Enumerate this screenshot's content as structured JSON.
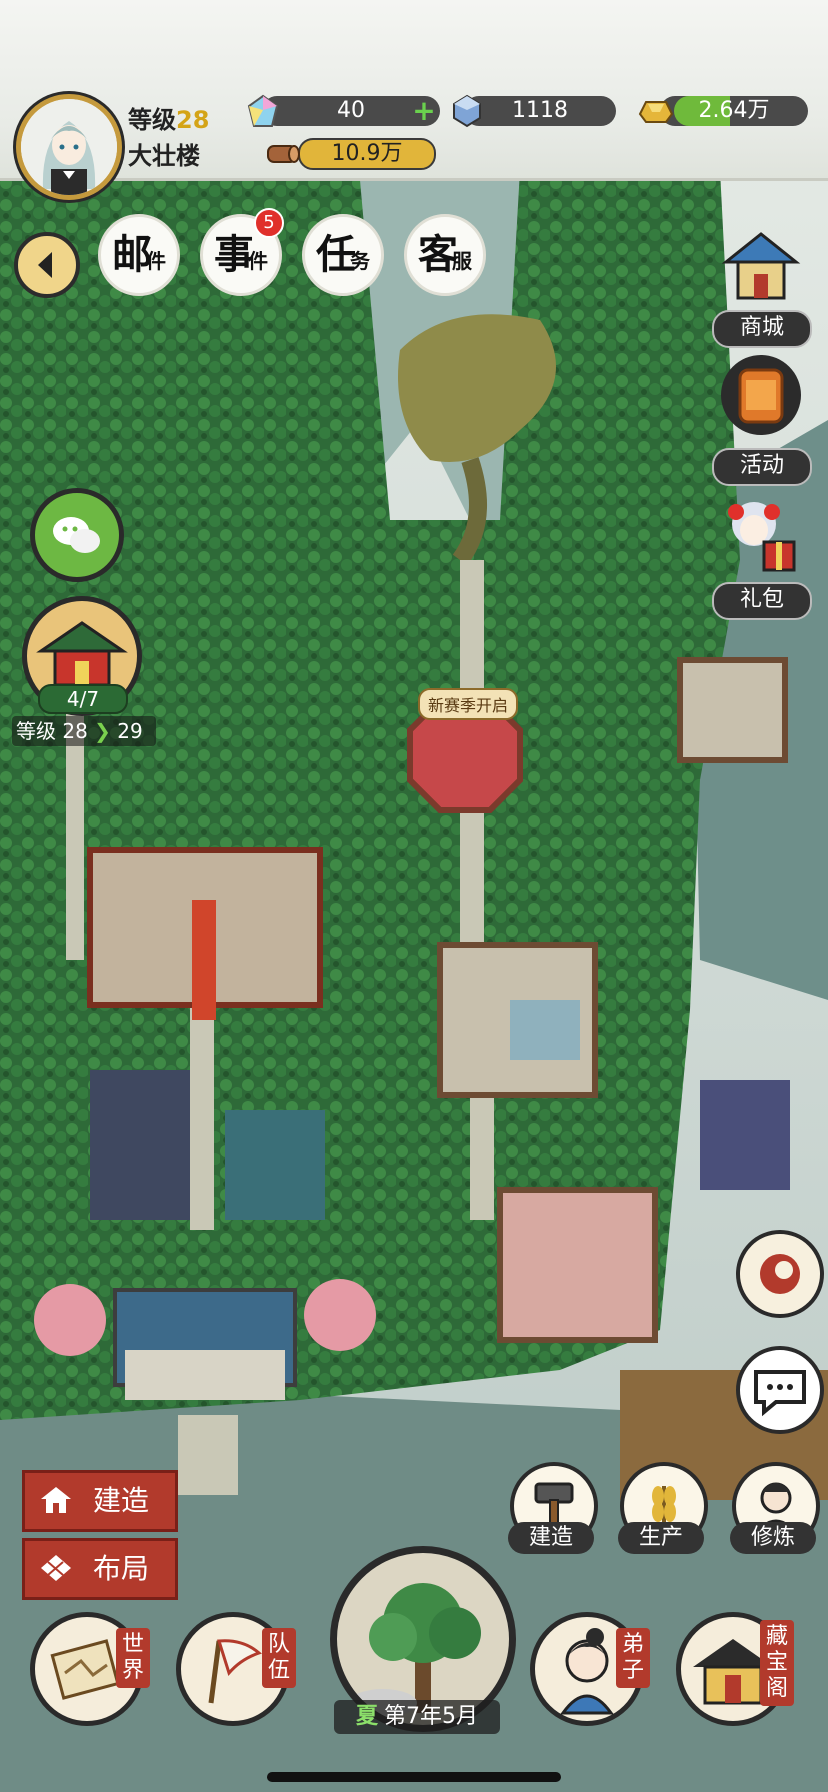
{
  "player": {
    "level_label": "等级",
    "level": "28",
    "sect_name": "大壮楼"
  },
  "resources": {
    "jade": "40",
    "crystal": "1118",
    "gold": "2.64万",
    "wood": "10.9万"
  },
  "quest_bar": {
    "mail": [
      "邮",
      "件"
    ],
    "events": [
      "事",
      "件"
    ],
    "events_badge": "5",
    "tasks": [
      "任",
      "务"
    ],
    "customer_service": [
      "客",
      "服"
    ]
  },
  "side_menu": {
    "shop": "商城",
    "activity": "活动",
    "gift": "礼包"
  },
  "hall": {
    "progress": "4/7",
    "level_label": "等级",
    "level_from": "28",
    "level_to": "29"
  },
  "map_labels": {
    "new_season": "新赛季开启"
  },
  "left_actions": {
    "build": "建造",
    "layout": "布局"
  },
  "action_row": {
    "build": "建造",
    "produce": "生产",
    "cultivate": "修炼"
  },
  "bottom_nav": {
    "world": [
      "世",
      "界"
    ],
    "team": [
      "队",
      "伍"
    ],
    "disciples": [
      "弟",
      "子"
    ],
    "treasury": [
      "藏",
      "宝",
      "阁"
    ]
  },
  "date": {
    "season": "夏",
    "text": "第7年5月"
  },
  "colors": {
    "forest": "#2f6a3a",
    "accent_red": "#b23a2c",
    "gold": "#d4a417",
    "plus_green": "#6ad14e"
  }
}
